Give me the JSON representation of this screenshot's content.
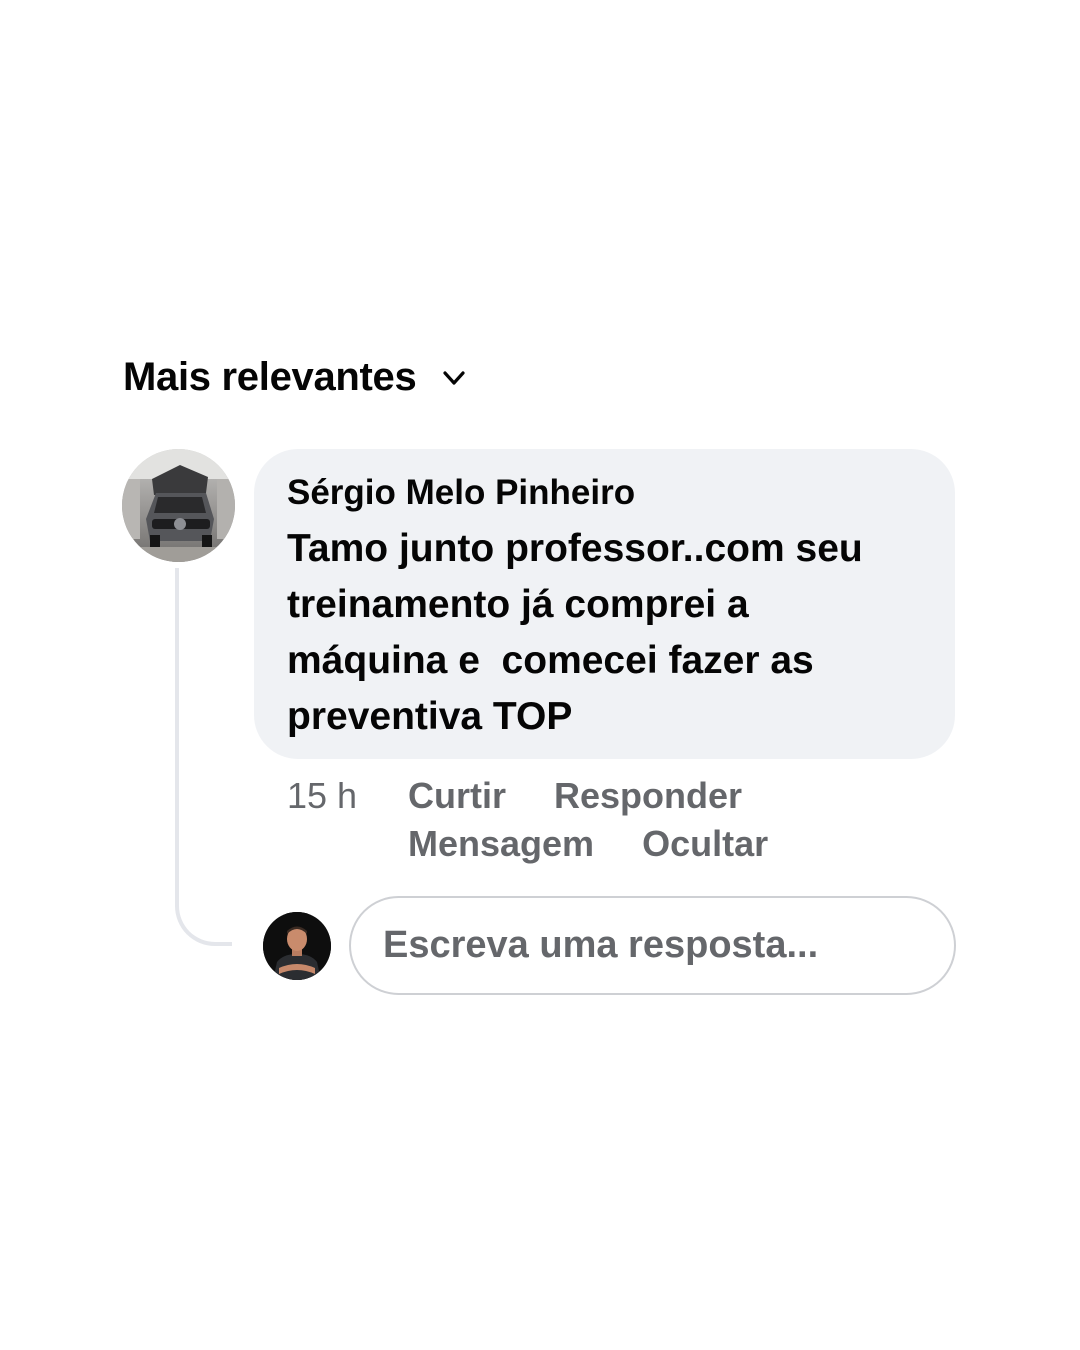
{
  "sort": {
    "label": "Mais relevantes",
    "icon": "chevron-down-icon"
  },
  "comment": {
    "author": "Sérgio Melo Pinheiro",
    "text": "Tamo junto professor..com seu\ntreinamento já comprei a\nmáquina e  comecei fazer as\npreventiva TOP",
    "time": "15 h",
    "actions": {
      "like": "Curtir",
      "reply": "Responder",
      "message": "Mensagem",
      "hide": "Ocultar"
    }
  },
  "reply_box": {
    "placeholder": "Escreva uma resposta..."
  },
  "colors": {
    "bubble_bg": "#f0f2f5",
    "secondary_text": "#65676b",
    "primary_text": "#050505",
    "thread_line": "#e4e6eb"
  }
}
